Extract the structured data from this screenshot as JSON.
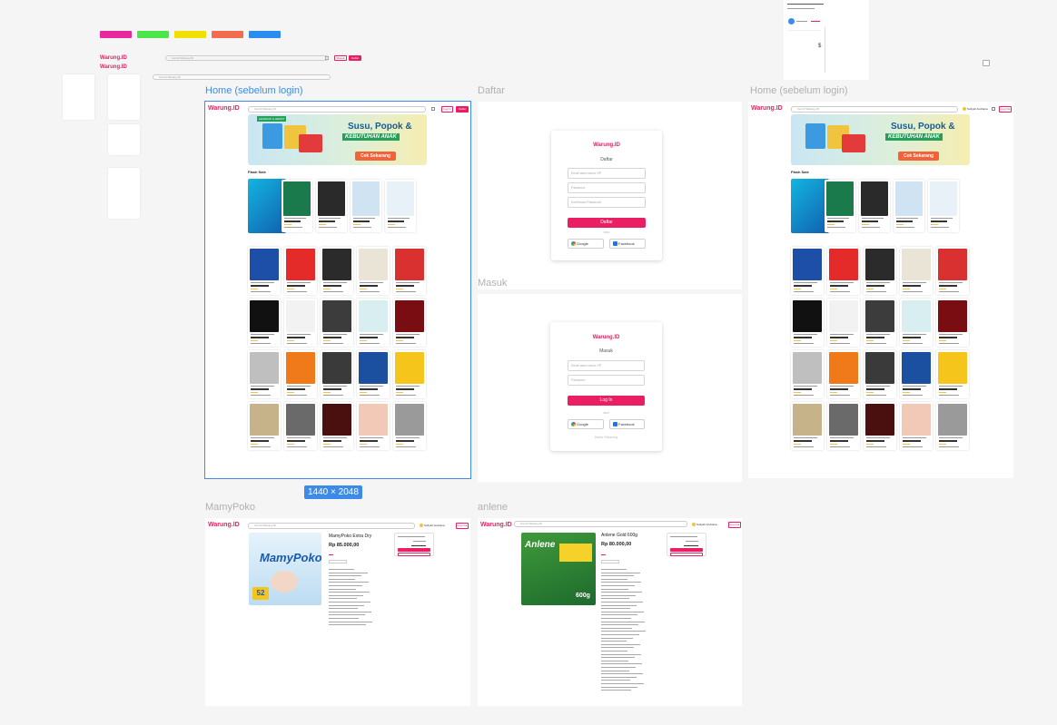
{
  "canvas": {
    "swatches": [
      {
        "name": "pink",
        "color": "#e8299b"
      },
      {
        "name": "green",
        "color": "#4be64a"
      },
      {
        "name": "yellow",
        "color": "#f0e000"
      },
      {
        "name": "orange",
        "color": "#f36c4f"
      },
      {
        "name": "blue",
        "color": "#2a8ef0"
      }
    ],
    "size_badge": "1440 × 2048"
  },
  "components": {
    "logo": "Warung.ID",
    "logo_small": "Warung.ID",
    "search_placeholder": "Cari di Warung.ID",
    "login_button": "Masuk",
    "register_button": "Daftar",
    "search_placeholder_2": "Cari di Warung.ID"
  },
  "frames": {
    "home_before_login": {
      "label": "Home (sebelum login)",
      "logo": "Warung.ID",
      "search": "Cari di Warung.ID",
      "login": "Log In",
      "register": "Daftar",
      "banner": {
        "badge": "LENGKAP & HEMAT",
        "title": "Susu, Popok &",
        "subtitle": "KEBUTUHAN ANAK",
        "cta": "Cek Sekarang"
      },
      "flash_sale": "Flash Sale"
    },
    "home_before_login_2": {
      "label": "Home (sebelum login)",
      "logo": "Warung.ID",
      "search": "Cari di Warung.ID",
      "user": "Sofiyah Andriana",
      "logout": "Log Out",
      "banner": {
        "title": "Susu, Popok &",
        "subtitle": "KEBUTUHAN ANAK",
        "cta": "Cek Sekarang"
      },
      "flash_sale": "Flash Sale"
    },
    "daftar": {
      "label": "Daftar",
      "logo": "Warung.ID",
      "title": "Daftar",
      "email_placeholder": "Email atau nomor HP",
      "password_placeholder": "Password",
      "confirm_placeholder": "Konfirmasi Password",
      "submit": "Daftar",
      "or": "atau",
      "google": "Google",
      "facebook": "Facebook"
    },
    "masuk": {
      "label": "Masuk",
      "logo": "Warung.ID",
      "title": "Masuk",
      "email_placeholder": "Email atau nomor HP",
      "password_placeholder": "Password",
      "submit": "Log In",
      "or": "atau",
      "google": "Google",
      "facebook": "Facebook",
      "register_link": "Daftar Sekarang"
    },
    "mamypoko": {
      "label": "MamyPoko",
      "logo": "Warung.ID",
      "search": "Cari di Warung.ID",
      "user": "Sofiyah Andriana",
      "logout": "Log Out",
      "product_title": "MamyPoko Extra Dry",
      "price": "Rp 85.000,00",
      "pack_label": "MamyPoko",
      "pack_count": "52"
    },
    "anlene": {
      "label": "anlene",
      "logo": "Warung.ID",
      "search": "Cari di Warung.ID",
      "user": "Sofiyah Andriana",
      "logout": "Log Out",
      "product_title": "Anlene Gold 600g",
      "price": "Rp 80.000,00",
      "pack_label": "Anlene",
      "pack_weight": "600g"
    }
  },
  "product_colors": [
    "#1e4fa8",
    "#e52a2a",
    "#2b2b2b",
    "#e9e4d6",
    "#d93030",
    "#111111",
    "#f2f2f2",
    "#3c3c3c",
    "#d8eef0",
    "#7a0d12",
    "#bfbfbf",
    "#f07a1a",
    "#3a3a3a",
    "#1b4fa0",
    "#f5c51c",
    "#c7b38a",
    "#6a6a6a",
    "#4a1010",
    "#f1c9b6",
    "#9a9a9a"
  ],
  "flash_colors": [
    "#1a7a4c",
    "#2a2a2a",
    "#cfe3f2",
    "#e8f1f7"
  ]
}
